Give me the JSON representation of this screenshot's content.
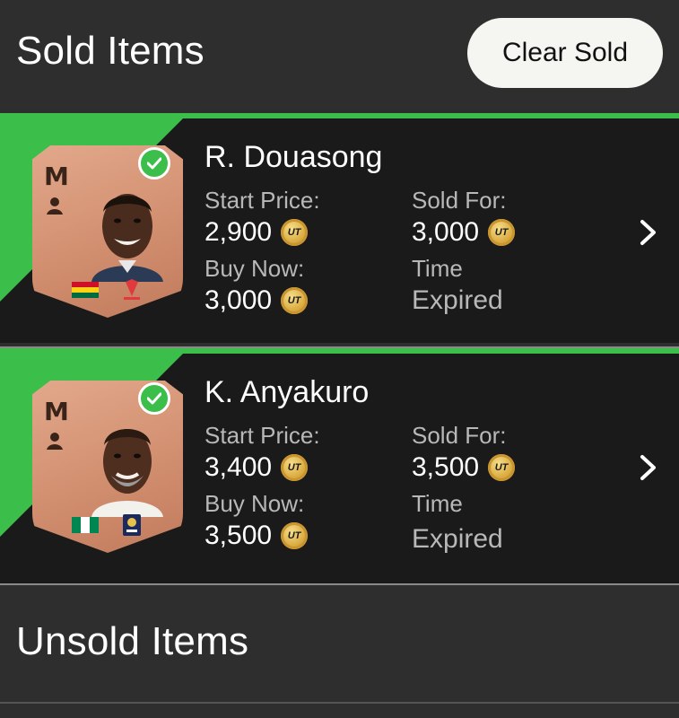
{
  "header": {
    "title": "Sold Items",
    "clear_label": "Clear Sold"
  },
  "items": [
    {
      "name": "R. Douasong",
      "position": "M",
      "start_price_label": "Start Price:",
      "start_price": "2,900",
      "buy_now_label": "Buy Now:",
      "buy_now": "3,000",
      "sold_for_label": "Sold For:",
      "sold_for": "3,000",
      "time_label": "Time",
      "time_value": "Expired",
      "nation": "Ghana"
    },
    {
      "name": "K. Anyakuro",
      "position": "M",
      "start_price_label": "Start Price:",
      "start_price": "3,400",
      "buy_now_label": "Buy Now:",
      "buy_now": "3,500",
      "sold_for_label": "Sold For:",
      "sold_for": "3,500",
      "time_label": "Time",
      "time_value": "Expired",
      "nation": "Nigeria"
    }
  ],
  "unsold": {
    "title": "Unsold Items"
  },
  "coin_label": "UT",
  "colors": {
    "accent_green": "#3bbf4a",
    "row_bg": "#1a1a1a",
    "page_bg": "#2e2e2e",
    "card_bronze": "#d59478"
  },
  "icons": {
    "coin": "coin-icon",
    "check": "check-icon",
    "chevron": "chevron-right-icon"
  }
}
